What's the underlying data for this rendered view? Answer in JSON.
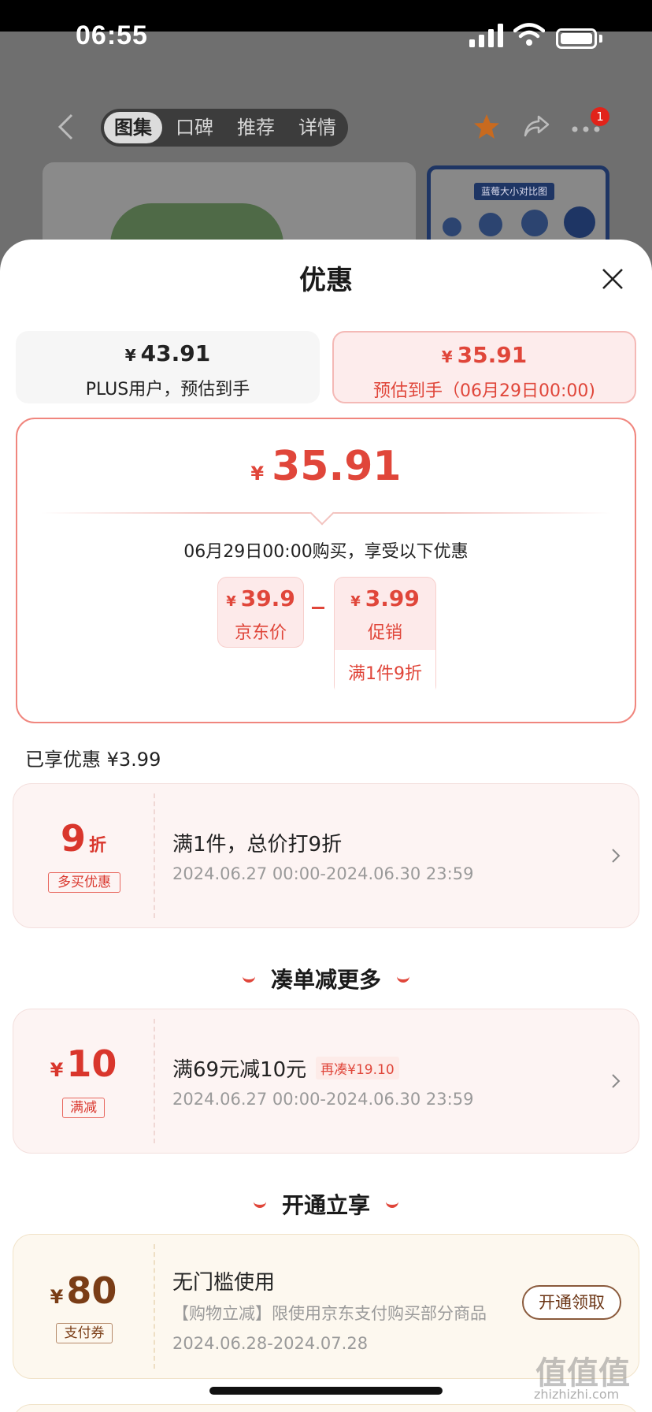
{
  "status_bar": {
    "time": "06:55"
  },
  "product_nav": {
    "tabs": [
      "图集",
      "口碑",
      "推荐",
      "详情"
    ],
    "active_tab": 0,
    "more_badge": "1",
    "thumb_label": "蓝莓大小对比图"
  },
  "sheet": {
    "title": "优惠",
    "options": [
      {
        "currency": "¥",
        "price": "43.91",
        "label": "PLUS用户，预估到手"
      },
      {
        "currency": "¥",
        "price": "35.91",
        "label": "预估到手（06月29日00:00)"
      }
    ],
    "calc": {
      "currency": "¥",
      "final_price": "35.91",
      "note": "06月29日00:00购买，享受以下优惠",
      "base": {
        "currency": "¥",
        "value": "39.9",
        "label": "京东价"
      },
      "discount": {
        "currency": "¥",
        "value": "3.99",
        "label": "促销",
        "condition": "满1件9折"
      }
    },
    "enjoyed": "已享优惠 ¥3.99",
    "promo1": {
      "big": "9",
      "big_unit": "折",
      "tag": "多买优惠",
      "title": "满1件，总价打9折",
      "period": "2024.06.27 00:00-2024.06.30 23:59"
    },
    "section_more": "凑单减更多",
    "promo2": {
      "currency": "¥",
      "big": "10",
      "tag": "满减",
      "title": "满69元减10元",
      "extra": "再凑¥19.10",
      "period": "2024.06.27 00:00-2024.06.30 23:59"
    },
    "section_open": "开通立享",
    "promo3": {
      "currency": "¥",
      "big": "80",
      "tag": "支付券",
      "title": "无门槛使用",
      "desc": "【购物立减】限使用京东支付购买部分商品",
      "period": "2024.06.28-2024.07.28",
      "button": "开通领取"
    }
  },
  "watermark": {
    "main": "值值值",
    "sub": "zhizhizhi.com"
  },
  "colors": {
    "accent_red": "#e0463a",
    "coupon_brown": "#7a3d16"
  }
}
